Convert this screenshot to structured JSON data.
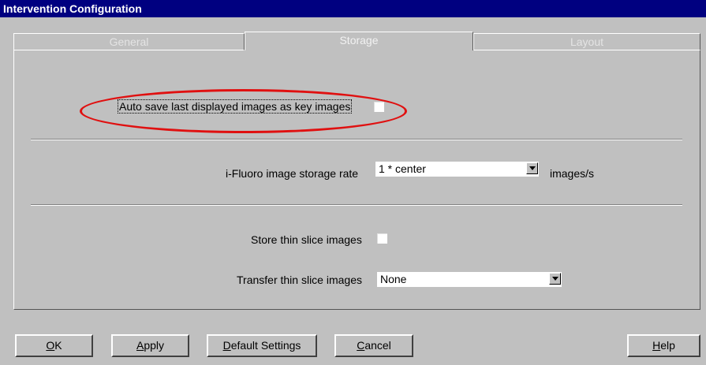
{
  "window": {
    "title": "Intervention Configuration"
  },
  "tabs": [
    {
      "label": "General",
      "active": false
    },
    {
      "label": "Storage",
      "active": true
    },
    {
      "label": "Layout",
      "active": false
    }
  ],
  "storage": {
    "auto_save": {
      "label": "Auto save last displayed images as key images",
      "checked": false
    },
    "storage_rate": {
      "label": "i-Fluoro image storage rate",
      "value": "1 * center",
      "unit": "images/s"
    },
    "store_thin": {
      "label": "Store thin slice images",
      "checked": false
    },
    "transfer_thin": {
      "label": "Transfer thin slice images",
      "value": "None"
    }
  },
  "buttons": {
    "ok": {
      "mnemonic": "O",
      "rest": "K"
    },
    "apply": {
      "mnemonic": "A",
      "rest": "pply"
    },
    "default_settings": {
      "mnemonic": "D",
      "rest": "efault Settings"
    },
    "cancel": {
      "mnemonic": "C",
      "rest": "ancel"
    },
    "help": {
      "mnemonic": "H",
      "rest": "elp"
    }
  },
  "colors": {
    "titlebar": "#000080",
    "face": "#c0c0c0",
    "highlight_ellipse": "#e01010"
  }
}
